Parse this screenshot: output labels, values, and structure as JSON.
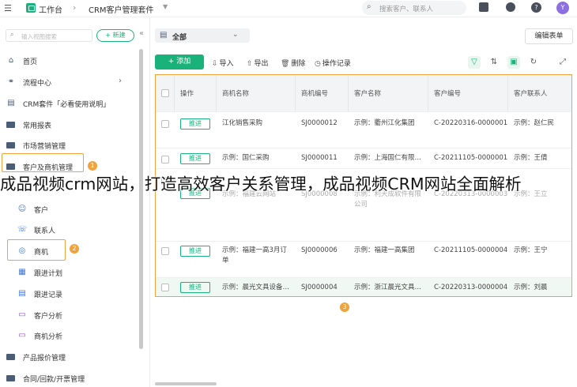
{
  "topbar": {
    "workspace": "工作台",
    "app_name": "CRM客户管理套件",
    "search_placeholder": "搜索客户、联系人",
    "avatar": "Y",
    "help": "?"
  },
  "sidebar": {
    "search_placeholder": "输入视图搜索",
    "new_label": "+ 新建",
    "items": [
      {
        "label": "首页",
        "icon": "home-icon"
      },
      {
        "label": "流程中心",
        "icon": "flow-icon"
      },
      {
        "label": "CRM套件「必看使用说明」",
        "icon": "doc-icon"
      },
      {
        "label": "常用报表",
        "icon": "folder-icon"
      },
      {
        "label": "市场营销管理",
        "icon": "folder-icon"
      },
      {
        "label": "客户及商机管理",
        "icon": "folder-icon"
      },
      {
        "label": "客户",
        "icon": "customer-icon"
      },
      {
        "label": "联系人",
        "icon": "contact-icon"
      },
      {
        "label": "商机",
        "icon": "opportunity-icon"
      },
      {
        "label": "跟进计划",
        "icon": "plan-icon"
      },
      {
        "label": "跟进记录",
        "icon": "record-icon"
      },
      {
        "label": "客户分析",
        "icon": "chart-icon"
      },
      {
        "label": "商机分析",
        "icon": "chart-icon"
      },
      {
        "label": "产品报价管理",
        "icon": "folder-icon"
      },
      {
        "label": "合同/回款/开票管理",
        "icon": "folder-icon"
      }
    ],
    "badge1": "1",
    "badge2": "2"
  },
  "main": {
    "view_label": "全部",
    "edit_form": "编辑表单",
    "add_label": "+ 添加",
    "tools": [
      "导入",
      "导出",
      "删除",
      "操作记录"
    ],
    "badge3": "3",
    "columns": [
      "操作",
      "商机名称",
      "商机编号",
      "客户名称",
      "客户编号",
      "客户联系人"
    ],
    "follow_label": "推进",
    "rows": [
      [
        "江化销售采购",
        "SJ0000012",
        "示例：衢州江化集团",
        "C-20220316-0000001",
        "示例：赵仁民"
      ],
      [
        "示例：国仁采购",
        "SJ0000011",
        "示例：上海国仁有限…",
        "C-20211105-0000001",
        "示例：王倩"
      ],
      [
        "示例：福建云网站",
        "SJ0000008",
        "示例：利天成软件有限公司",
        "C-20220313-0000003",
        "示例：王立"
      ],
      [
        "示例：福建一高3月订单",
        "SJ0000006",
        "示例：福建一高集团",
        "C-20211105-0000004",
        "示例：王宁"
      ],
      [
        "示例：晨光文具设备…",
        "SJ0000004",
        "示例：浙江晨光文具…",
        "C-20220313-0000004",
        "示例：刘晨"
      ]
    ]
  },
  "caption": "成品视频crm网站，打造高效客户关系管理，成品视频CRM网站全面解析"
}
